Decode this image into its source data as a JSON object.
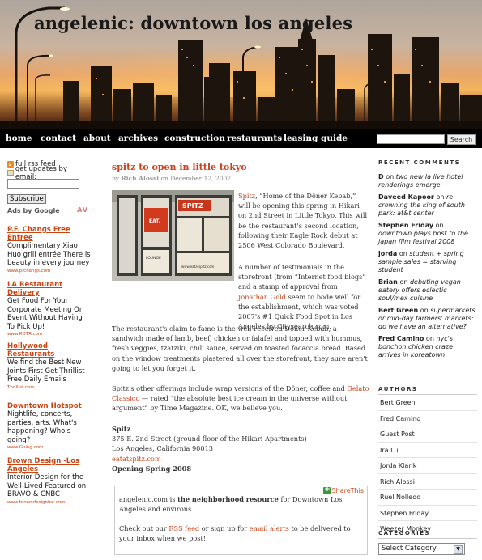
{
  "site": {
    "title": "angelenic: downtown los angeles"
  },
  "nav": {
    "items": [
      "home",
      "contact",
      "about",
      "archives",
      "construction",
      "restaurants",
      "leasing guide"
    ],
    "search_placeholder": "",
    "search_button": "Search"
  },
  "left_sidebar": {
    "rss_label": "full rss feed",
    "email_label": "get updates by email:",
    "email_value": "",
    "subscribe_button": "Subscribe",
    "ads_by": "Ads by Google",
    "ads_av": "AV",
    "ads": [
      {
        "title": "P.F. Changs Free Entree",
        "body": "Complimentary Xiao Huo grill entrée There is beauty in every journey",
        "url": "www.pfchangs.com"
      },
      {
        "title": "LA Restaurant Delivery",
        "body": "Get Food For Your Corporate Meeting Or Event Without Having To Pick Up!",
        "url": "www.ROTR.com"
      },
      {
        "title": "Hollywood Restaurants",
        "body": "We find the Best New Joints First Get Thrillist Free Daily Emails",
        "url": "Thrillist.com"
      },
      {
        "title": "Downtown Hotspot",
        "body": "Nightlife, concerts, parties, arts. What's happening? Who's going?",
        "url": "www.Going.com"
      },
      {
        "title": "Brown Design -Los Angeles",
        "body": "Interior Design for the Well-Lived Featured on BRAVO & CNBC",
        "url": "www.browndesigninc.com"
      }
    ]
  },
  "post": {
    "title": "spitz to open in little tokyo",
    "meta_by": "by",
    "author": "Rich Alossi",
    "meta_on": "on December 12, 2007",
    "p1_link": "Spitz",
    "p1_text": ", “Home of the Döner Kebab,” will be opening this spring in Hikari on 2nd Street in Little Tokyo. This will be the restaurant's second location, following their Eagle Rock debut at 2506 West Colorado Boulevard.",
    "p2_a": "A number of testimonials in the storefront (from “Internet food blogs” and a stamp of approval from",
    "p2_link": "Jonathan Gold",
    "p2_b": "seem to bode well for the establishment, which was voted 2007's #1 Quick Food Spot in Los Angeles by Citysearch.com.",
    "p3": "The restaurant's claim to fame is the well-received Döner Kebab, a sandwich made of lamb, beef, chicken or falafel and topped with hummus, fresh veggies, tzatziki, chili sauce, served on toasted focaccia bread. Based on the window treatments plastered all over the storefront, they sure aren't going to let you forget it.",
    "p4_a": "Spitz's other offerings include wrap versions of the Döner, coffee and",
    "p4_link": "Gelato Classico",
    "p4_b": "— rated “the absolute best ice cream in the universe without argument” by Time Magazine. OK, we believe you.",
    "address": {
      "name": "Spitz",
      "line1": "375 E. 2nd Street (ground floor of the Hikari Apartments)",
      "line2": "Los Angeles, California 90013",
      "url": "eatatspitz.com",
      "opening": "Opening Spring 2008"
    },
    "image_signs": {
      "spitz": "SPITZ",
      "eat": "EAT.",
      "lounge": "LOUNGE",
      "url": "www.eatatspitz.com"
    }
  },
  "share_box": {
    "share_label": "ShareThis",
    "l1_a": "angelenic.com is",
    "l1_b": "the neighborhood resource",
    "l1_c": "for Downtown Los Angeles and environs.",
    "l2_a": "Check out our",
    "l2_link1": "RSS feed",
    "l2_b": "or sign up for",
    "l2_link2": "email alerts",
    "l2_c": "to be delivered to your inbox when we post!"
  },
  "right_sidebar": {
    "recent_comments_heading": "RECENT COMMENTS",
    "comments": [
      {
        "who": "D",
        "on": "on",
        "post": "two new la live hotel renderings emerge"
      },
      {
        "who": "Daveed Kapoor",
        "on": "on",
        "post": "re-crowning the king of south park: at&t center"
      },
      {
        "who": "Stephen Friday",
        "on": "on",
        "post": "downtown plays host to the japan film festival 2008"
      },
      {
        "who": "jorda",
        "on": "on",
        "post": "student + spring sample sales = starving student"
      },
      {
        "who": "Brian",
        "on": "on",
        "post": "debuting vegan eatery offers eclectic soul/mex cuisine"
      },
      {
        "who": "Bert Green",
        "on": "on",
        "post": "supermarkets or mid-day farmers' markets: do we have an alternative?"
      },
      {
        "who": "Fred Camino",
        "on": "on",
        "post": "nyc's bonchon chicken craze arrives in koreatown"
      }
    ],
    "authors_heading": "AUTHORS",
    "authors": [
      "Bert Green",
      "Fred Camino",
      "Guest Post",
      "Ira Lu",
      "Jorda Klarik",
      "Rich Alossi",
      "Ruel Nolledo",
      "Stephen Friday",
      "Weezer Monkey"
    ],
    "categories_heading": "CATEGORIES",
    "category_select": "Select Category"
  }
}
